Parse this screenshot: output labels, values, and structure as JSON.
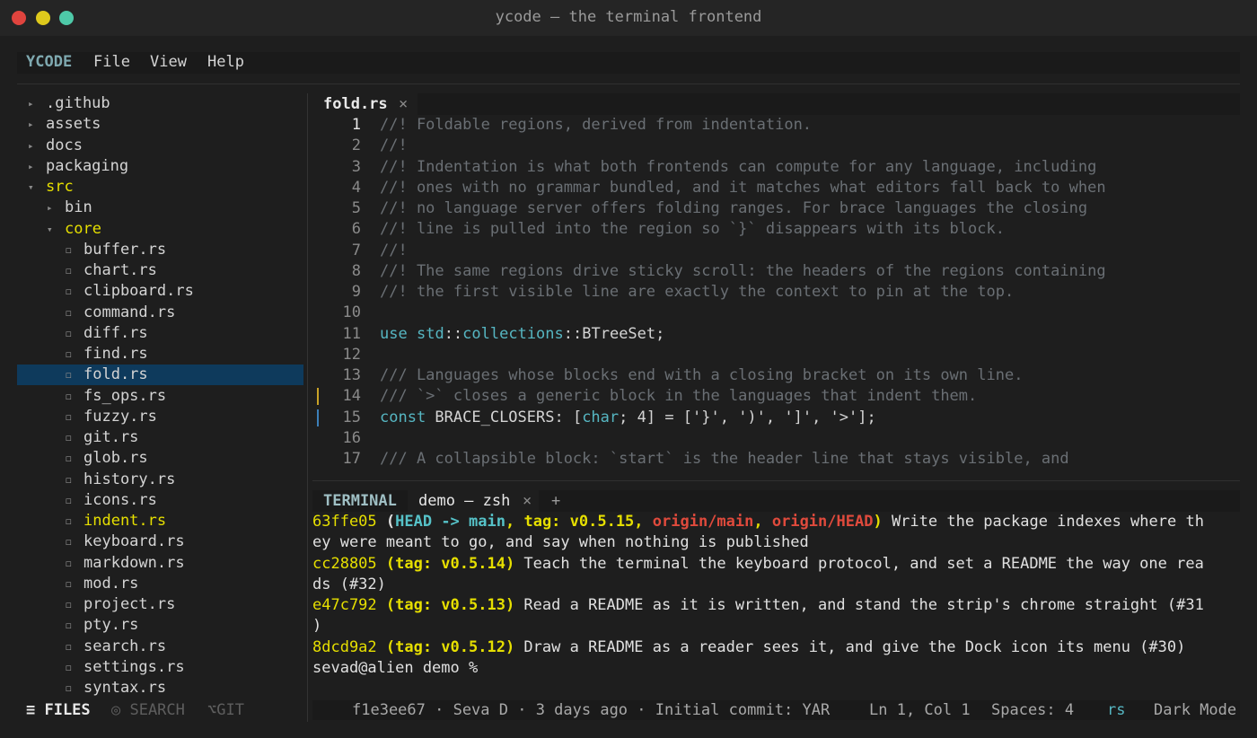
{
  "window": {
    "title": "ycode — the terminal frontend"
  },
  "menubar": {
    "app_name": "YCODE",
    "items": [
      "File",
      "View",
      "Help"
    ]
  },
  "sidebar": {
    "rows": [
      {
        "label": ".github",
        "marker": "▸",
        "depth": 0,
        "kind": "folder"
      },
      {
        "label": "assets",
        "marker": "▸",
        "depth": 0,
        "kind": "folder"
      },
      {
        "label": "docs",
        "marker": "▸",
        "depth": 0,
        "kind": "folder"
      },
      {
        "label": "packaging",
        "marker": "▸",
        "depth": 0,
        "kind": "folder"
      },
      {
        "label": "src",
        "marker": "▾",
        "depth": 0,
        "kind": "folder-open"
      },
      {
        "label": "bin",
        "marker": "▸",
        "depth": 1,
        "kind": "folder"
      },
      {
        "label": "core",
        "marker": "▾",
        "depth": 1,
        "kind": "folder-open"
      },
      {
        "label": "buffer.rs",
        "marker": "◻",
        "depth": 2,
        "kind": "file"
      },
      {
        "label": "chart.rs",
        "marker": "◻",
        "depth": 2,
        "kind": "file"
      },
      {
        "label": "clipboard.rs",
        "marker": "◻",
        "depth": 2,
        "kind": "file"
      },
      {
        "label": "command.rs",
        "marker": "◻",
        "depth": 2,
        "kind": "file"
      },
      {
        "label": "diff.rs",
        "marker": "◻",
        "depth": 2,
        "kind": "file"
      },
      {
        "label": "find.rs",
        "marker": "◻",
        "depth": 2,
        "kind": "file"
      },
      {
        "label": "fold.rs",
        "marker": "◻",
        "depth": 2,
        "kind": "file-selected"
      },
      {
        "label": "fs_ops.rs",
        "marker": "◻",
        "depth": 2,
        "kind": "file"
      },
      {
        "label": "fuzzy.rs",
        "marker": "◻",
        "depth": 2,
        "kind": "file"
      },
      {
        "label": "git.rs",
        "marker": "◻",
        "depth": 2,
        "kind": "file"
      },
      {
        "label": "glob.rs",
        "marker": "◻",
        "depth": 2,
        "kind": "file"
      },
      {
        "label": "history.rs",
        "marker": "◻",
        "depth": 2,
        "kind": "file"
      },
      {
        "label": "icons.rs",
        "marker": "◻",
        "depth": 2,
        "kind": "file"
      },
      {
        "label": "indent.rs",
        "marker": "◻",
        "depth": 2,
        "kind": "file-modified"
      },
      {
        "label": "keyboard.rs",
        "marker": "◻",
        "depth": 2,
        "kind": "file"
      },
      {
        "label": "markdown.rs",
        "marker": "◻",
        "depth": 2,
        "kind": "file"
      },
      {
        "label": "mod.rs",
        "marker": "◻",
        "depth": 2,
        "kind": "file"
      },
      {
        "label": "project.rs",
        "marker": "◻",
        "depth": 2,
        "kind": "file"
      },
      {
        "label": "pty.rs",
        "marker": "◻",
        "depth": 2,
        "kind": "file"
      },
      {
        "label": "search.rs",
        "marker": "◻",
        "depth": 2,
        "kind": "file"
      },
      {
        "label": "settings.rs",
        "marker": "◻",
        "depth": 2,
        "kind": "file"
      },
      {
        "label": "syntax.rs",
        "marker": "◻",
        "depth": 2,
        "kind": "file"
      }
    ],
    "tabs": {
      "files": "≡ FILES",
      "search": "◎ SEARCH",
      "git": "⌥GIT"
    }
  },
  "editor": {
    "tab": {
      "name": "fold.rs",
      "close": "×"
    },
    "current_line": 1,
    "lines": [
      {
        "n": "1",
        "parts": [
          {
            "t": "//! Foldable regions, derived from indentation.",
            "c": "comment"
          }
        ]
      },
      {
        "n": "2",
        "parts": [
          {
            "t": "//!",
            "c": "comment"
          }
        ]
      },
      {
        "n": "3",
        "parts": [
          {
            "t": "//! Indentation is what both frontends can compute for any language, including",
            "c": "comment"
          }
        ]
      },
      {
        "n": "4",
        "parts": [
          {
            "t": "//! ones with no grammar bundled, and it matches what editors fall back to when",
            "c": "comment"
          }
        ]
      },
      {
        "n": "5",
        "parts": [
          {
            "t": "//! no language server offers folding ranges. For brace languages the closing",
            "c": "comment"
          }
        ]
      },
      {
        "n": "6",
        "parts": [
          {
            "t": "//! line is pulled into the region so `}` disappears with its block.",
            "c": "comment"
          }
        ]
      },
      {
        "n": "7",
        "parts": [
          {
            "t": "//!",
            "c": "comment"
          }
        ]
      },
      {
        "n": "8",
        "parts": [
          {
            "t": "//! The same regions drive sticky scroll: the headers of the regions containing",
            "c": "comment"
          }
        ]
      },
      {
        "n": "9",
        "parts": [
          {
            "t": "//! the first visible line are exactly the context to pin at the top.",
            "c": "comment"
          }
        ]
      },
      {
        "n": "10",
        "parts": []
      },
      {
        "n": "11",
        "parts": [
          {
            "t": "use",
            "c": "keyword"
          },
          {
            "t": " ",
            "c": "ident"
          },
          {
            "t": "std",
            "c": "type"
          },
          {
            "t": "::",
            "c": "ident"
          },
          {
            "t": "collections",
            "c": "type"
          },
          {
            "t": "::",
            "c": "ident"
          },
          {
            "t": "BTreeSet;",
            "c": "ident"
          }
        ]
      },
      {
        "n": "12",
        "parts": []
      },
      {
        "n": "13",
        "parts": [
          {
            "t": "/// Languages whose blocks end with a closing bracket on its own line.",
            "c": "comment"
          }
        ]
      },
      {
        "n": "14",
        "gutter": "yellow",
        "parts": [
          {
            "t": "/// `>` closes a generic block in the languages that indent them.",
            "c": "comment"
          }
        ]
      },
      {
        "n": "15",
        "gutter": "blue",
        "parts": [
          {
            "t": "const",
            "c": "keyword"
          },
          {
            "t": " BRACE_CLOSERS: [",
            "c": "ident"
          },
          {
            "t": "char",
            "c": "type"
          },
          {
            "t": "; 4] = ['}', ')', ']', '>'];",
            "c": "ident"
          }
        ]
      },
      {
        "n": "16",
        "parts": []
      },
      {
        "n": "17",
        "parts": [
          {
            "t": "/// A collapsible block: `start` is the header line that stays visible, and",
            "c": "comment"
          }
        ]
      }
    ]
  },
  "terminal": {
    "label": "TERMINAL",
    "tab": {
      "name": "demo — zsh",
      "close": "×"
    },
    "add": "+",
    "lines": [
      [
        {
          "t": "63ffe05",
          "c": "hash"
        },
        {
          "t": " (",
          "c": "refbold"
        },
        {
          "t": "HEAD -> ",
          "c": "ref-c"
        },
        {
          "t": "main",
          "c": "ref-c"
        },
        {
          "t": ", ",
          "c": "ref-y"
        },
        {
          "t": "tag: v0.5.15",
          "c": "ref-y"
        },
        {
          "t": ", ",
          "c": "ref-y"
        },
        {
          "t": "origin/main",
          "c": "ref-r"
        },
        {
          "t": ", ",
          "c": "ref-y"
        },
        {
          "t": "origin/HEAD",
          "c": "ref-r"
        },
        {
          "t": ")",
          "c": "ref-y"
        },
        {
          "t": " Write the package indexes where th",
          "c": "plain"
        }
      ],
      [
        {
          "t": "ey were meant to go, and say when nothing is published",
          "c": "plain"
        }
      ],
      [
        {
          "t": "cc28805",
          "c": "hash"
        },
        {
          "t": " (tag: v0.5.14)",
          "c": "ref-y"
        },
        {
          "t": " Teach the terminal the keyboard protocol, and set a README the way one rea",
          "c": "plain"
        }
      ],
      [
        {
          "t": "ds (#32)",
          "c": "plain"
        }
      ],
      [
        {
          "t": "e47c792",
          "c": "hash"
        },
        {
          "t": " (tag: v0.5.13)",
          "c": "ref-y"
        },
        {
          "t": " Read a README as it is written, and stand the strip's chrome straight (#31",
          "c": "plain"
        }
      ],
      [
        {
          "t": ")",
          "c": "plain"
        }
      ],
      [
        {
          "t": "8dcd9a2",
          "c": "hash"
        },
        {
          "t": " (tag: v0.5.12)",
          "c": "ref-y"
        },
        {
          "t": " Draw a README as a reader sees it, and give the Dock icon its menu (#30)",
          "c": "plain"
        }
      ],
      [
        {
          "t": "sevad@alien demo % ",
          "c": "plain"
        }
      ]
    ]
  },
  "statusbar": {
    "blame": "f1e3ee67 · Seva D · 3 days ago · Initial commit: YAR",
    "position": "Ln 1, Col 1",
    "spaces": "Spaces: 4",
    "lang": "rs",
    "mode": "Dark Mode"
  },
  "colors": {
    "background": "#1e1e1e",
    "accent_yellow": "#e6df00",
    "accent_cyan": "#56b6c2",
    "accent_red": "#e04a3c",
    "selection": "#0e3a5c",
    "traffic_red": "#e0443e",
    "traffic_yellow": "#dec91c",
    "traffic_green": "#4ec9a8"
  }
}
